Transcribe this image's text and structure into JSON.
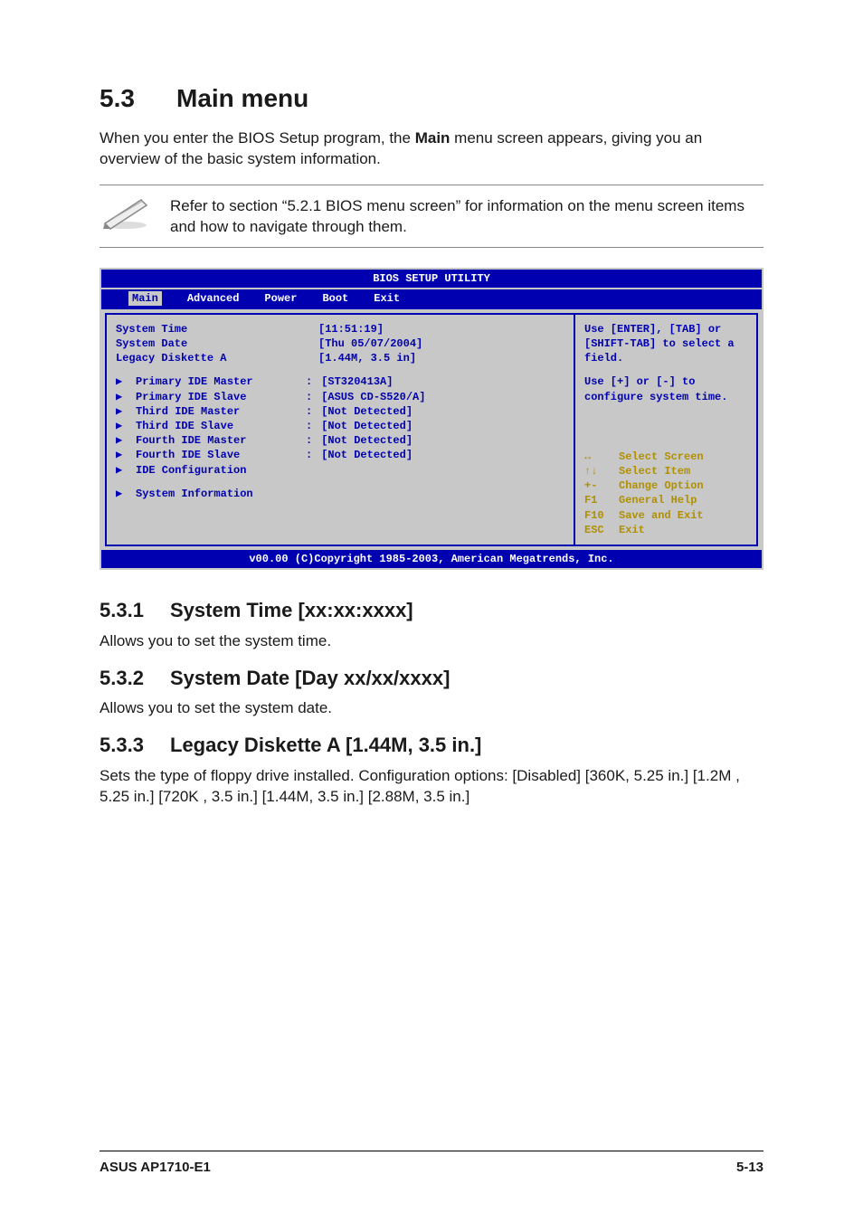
{
  "section": {
    "number": "5.3",
    "title": "Main menu"
  },
  "intro_pre": "When you enter the BIOS Setup program, the ",
  "intro_bold": "Main",
  "intro_post": " menu screen appears, giving you an overview of the basic system information.",
  "note": "Refer to section “5.2.1  BIOS menu screen” for information on the menu screen items and how to navigate through them.",
  "bios": {
    "title": "BIOS SETUP UTILITY",
    "tabs": [
      "Main",
      "Advanced",
      "Power",
      "Boot",
      "Exit"
    ],
    "selected_tab": "Main",
    "fields": {
      "system_time": {
        "label": "System Time",
        "value": "[11:51:19]"
      },
      "system_date": {
        "label": "System Date",
        "value": "[Thu 05/07/2004]"
      },
      "legacy_diskette_a": {
        "label": "Legacy Diskette A",
        "value": "[1.44M, 3.5 in]"
      }
    },
    "ide": [
      {
        "label": "Primary IDE Master",
        "value": "[ST320413A]"
      },
      {
        "label": "Primary IDE Slave",
        "value": "[ASUS CD-S520/A]"
      },
      {
        "label": "Third IDE Master",
        "value": "[Not Detected]"
      },
      {
        "label": "Third IDE Slave",
        "value": "[Not Detected]"
      },
      {
        "label": "Fourth IDE Master",
        "value": "[Not Detected]"
      },
      {
        "label": "Fourth IDE Slave",
        "value": "[Not Detected]"
      }
    ],
    "ide_config_label": "IDE Configuration",
    "sysinfo_label": "System Information",
    "help_top": "Use [ENTER], [TAB] or [SHIFT-TAB] to select a field.",
    "help_mid": "Use [+] or [-] to configure system time.",
    "nav": [
      {
        "icon": "↔",
        "label": "Select Screen"
      },
      {
        "icon": "↑↓",
        "label": "Select Item"
      },
      {
        "icon": "+-",
        "label": "Change Option"
      },
      {
        "icon": "F1",
        "label": "General Help"
      },
      {
        "icon": "F10",
        "label": "Save and Exit"
      },
      {
        "icon": "ESC",
        "label": "Exit"
      }
    ],
    "footer": "v00.00 (C)Copyright 1985-2003, American Megatrends, Inc."
  },
  "sub1": {
    "num": "5.3.1",
    "title": "System Time [xx:xx:xxxx]",
    "body": "Allows you to set the system time."
  },
  "sub2": {
    "num": "5.3.2",
    "title": "System Date [Day xx/xx/xxxx]",
    "body": "Allows you to set the system date."
  },
  "sub3": {
    "num": "5.3.3",
    "title": "Legacy Diskette A [1.44M, 3.5 in.]",
    "body": "Sets the type of floppy drive installed. Configuration options: [Disabled] [360K, 5.25 in.] [1.2M , 5.25 in.] [720K , 3.5 in.] [1.44M, 3.5 in.] [2.88M, 3.5 in.]"
  },
  "footer": {
    "left": "ASUS AP1710-E1",
    "right": "5-13"
  }
}
